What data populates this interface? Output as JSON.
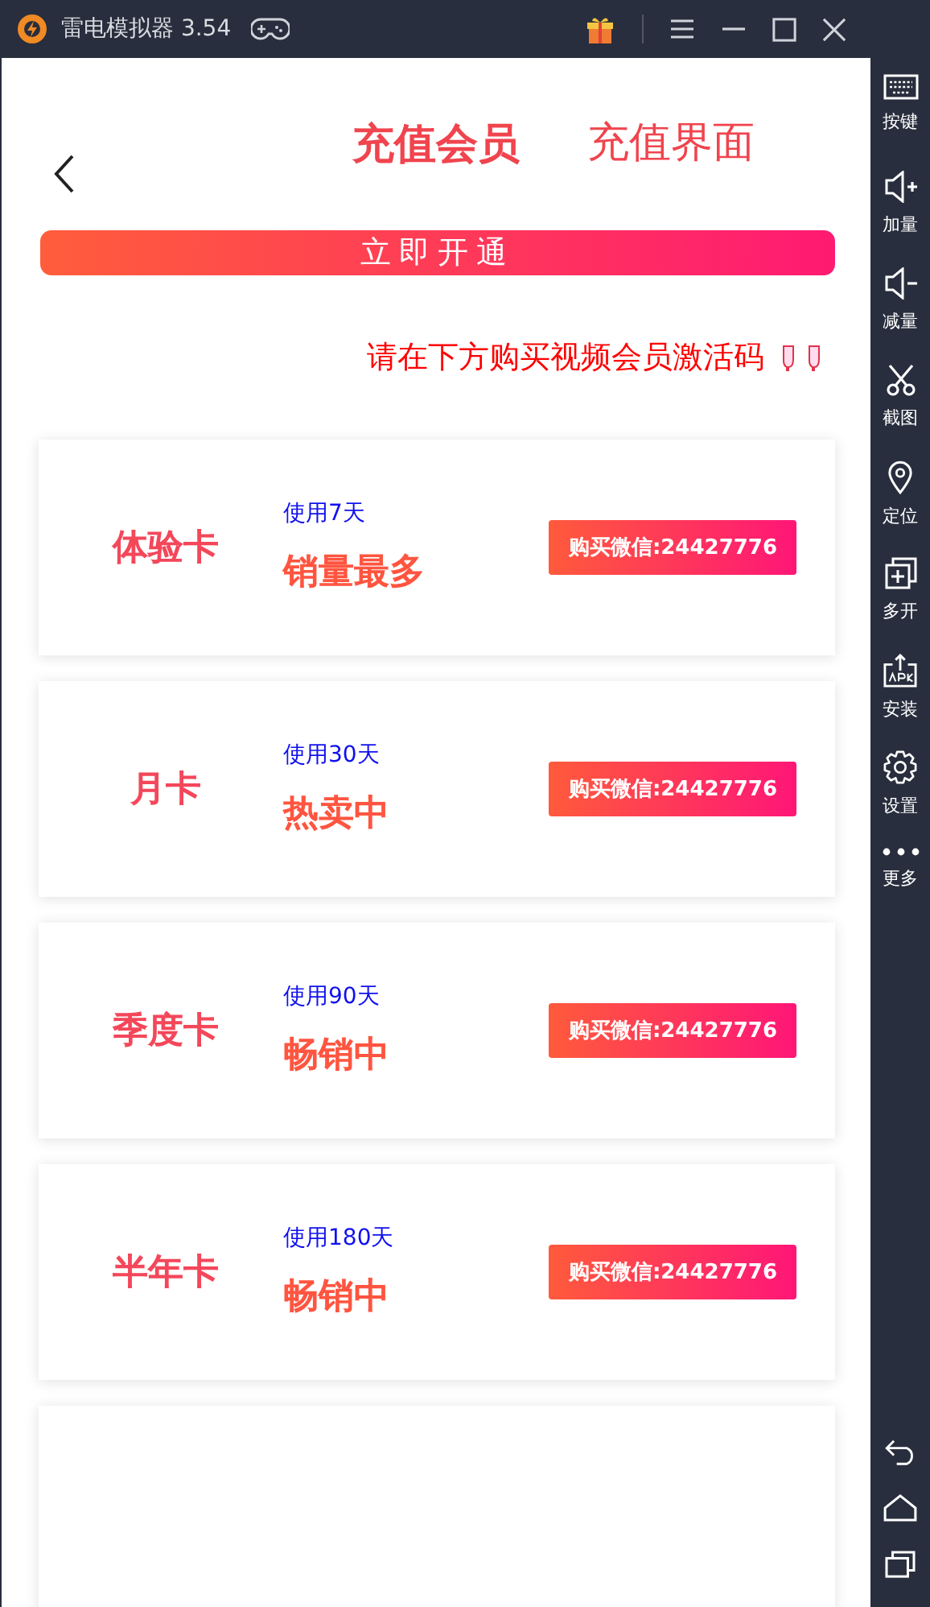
{
  "window": {
    "title": "雷电模拟器 3.54"
  },
  "sidebar": {
    "items": [
      {
        "kind": "keyboard",
        "label": "按键"
      },
      {
        "kind": "volup",
        "label": "加量"
      },
      {
        "kind": "voldown",
        "label": "减量"
      },
      {
        "kind": "scissors",
        "label": "截图"
      },
      {
        "kind": "pin",
        "label": "定位"
      },
      {
        "kind": "multi",
        "label": "多开"
      },
      {
        "kind": "apk",
        "label": "安装"
      },
      {
        "kind": "gear",
        "label": "设置"
      },
      {
        "kind": "dots",
        "label": "更多"
      }
    ]
  },
  "page": {
    "title": "充值会员",
    "subtitle": "充值界面",
    "open_button": "立即开通",
    "hint": "请在下方购买视频会员激活码",
    "cards": [
      {
        "name": "体验卡",
        "usage": "使用7天",
        "tag": "销量最多",
        "buy": "购买微信:24427776"
      },
      {
        "name": "月卡",
        "usage": "使用30天",
        "tag": "热卖中",
        "buy": "购买微信:24427776"
      },
      {
        "name": "季度卡",
        "usage": "使用90天",
        "tag": "畅销中",
        "buy": "购买微信:24427776"
      },
      {
        "name": "半年卡",
        "usage": "使用180天",
        "tag": "畅销中",
        "buy": "购买微信:24427776"
      }
    ]
  }
}
